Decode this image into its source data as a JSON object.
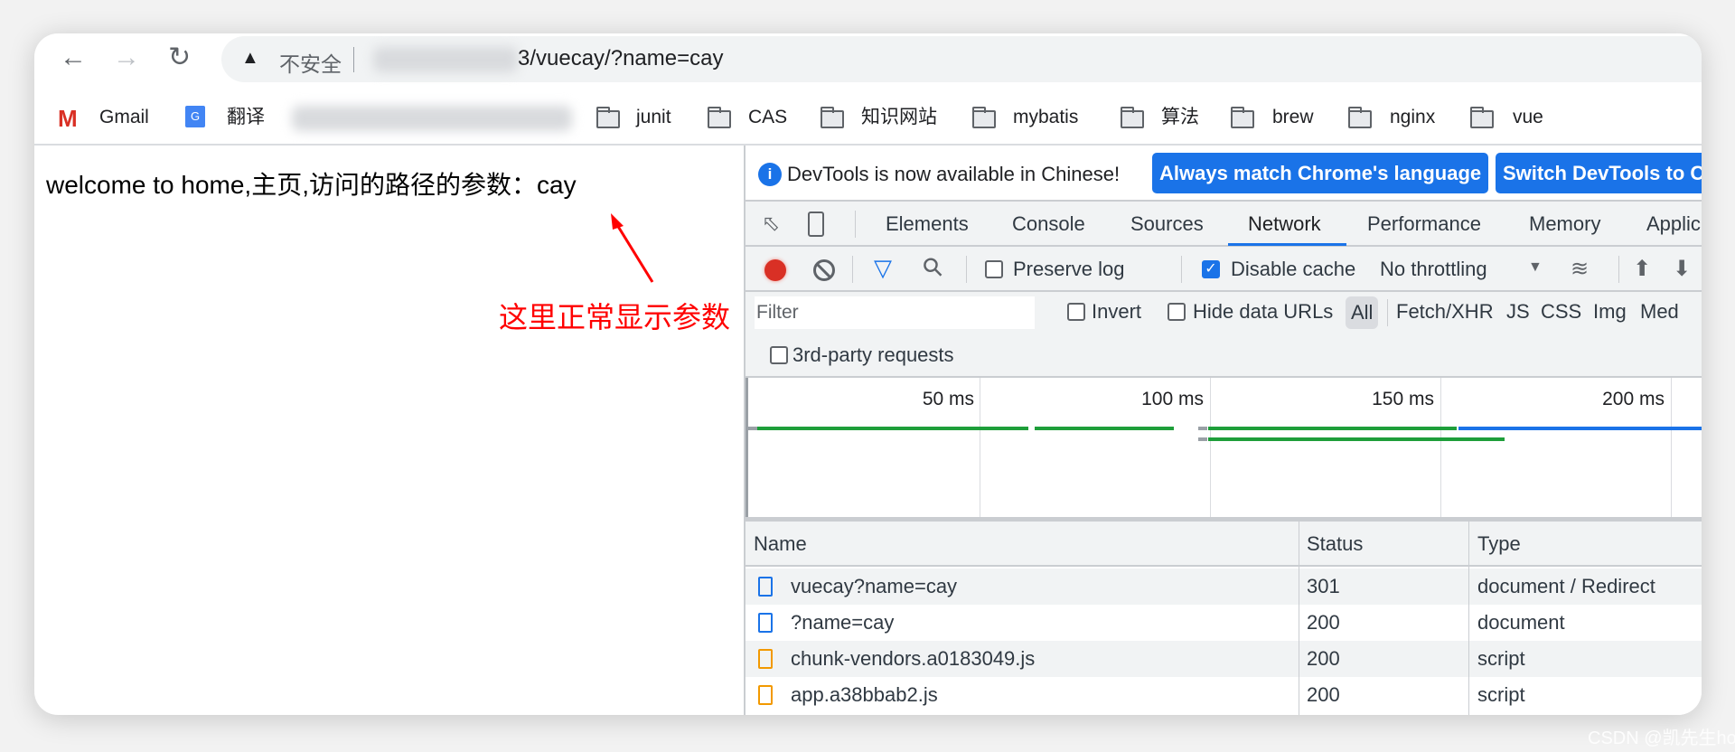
{
  "browser": {
    "address_warning": "不安全",
    "url_visible": "3/vuecay/?name=cay",
    "bookmarks": [
      {
        "label": "Gmail",
        "icon": "gmail-icon"
      },
      {
        "label": "翻译",
        "icon": "translate-icon"
      },
      {
        "label": "junit",
        "icon": "folder-icon"
      },
      {
        "label": "CAS",
        "icon": "folder-icon"
      },
      {
        "label": "知识网站",
        "icon": "folder-icon"
      },
      {
        "label": "mybatis",
        "icon": "folder-icon"
      },
      {
        "label": "算法",
        "icon": "folder-icon"
      },
      {
        "label": "brew",
        "icon": "folder-icon"
      },
      {
        "label": "nginx",
        "icon": "folder-icon"
      },
      {
        "label": "vue",
        "icon": "folder-icon"
      }
    ]
  },
  "page": {
    "text": "welcome to home,主页,访问的路径的参数：cay",
    "annotation": "这里正常显示参数",
    "annotation_color": "#ff0000"
  },
  "devtools": {
    "infobar": {
      "message": "DevTools is now available in Chinese!",
      "button1": "Always match Chrome's language",
      "button2": "Switch DevTools to C"
    },
    "tabs": [
      "Elements",
      "Console",
      "Sources",
      "Network",
      "Performance",
      "Memory",
      "Applic"
    ],
    "active_tab": "Network",
    "toolbar": {
      "preserve_log": "Preserve log",
      "preserve_log_checked": false,
      "disable_cache": "Disable cache",
      "disable_cache_checked": true,
      "throttling": "No throttling"
    },
    "filter": {
      "placeholder": "Filter",
      "invert": "Invert",
      "hide_data_urls": "Hide data URLs",
      "types": [
        "All",
        "Fetch/XHR",
        "JS",
        "CSS",
        "Img",
        "Med"
      ],
      "active_type": "All",
      "third_party": "3rd-party requests"
    },
    "timeline": {
      "ticks": [
        "50 ms",
        "100 ms",
        "150 ms",
        "200 ms"
      ]
    },
    "table": {
      "columns": [
        "Name",
        "Status",
        "Type"
      ],
      "rows": [
        {
          "name": "vuecay?name=cay",
          "status": "301",
          "type": "document / Redirect",
          "icon": "document-icon"
        },
        {
          "name": "?name=cay",
          "status": "200",
          "type": "document",
          "icon": "document-icon"
        },
        {
          "name": "chunk-vendors.a0183049.js",
          "status": "200",
          "type": "script",
          "icon": "script-icon"
        },
        {
          "name": "app.a38bbab2.js",
          "status": "200",
          "type": "script",
          "icon": "script-icon"
        }
      ]
    },
    "accent": "#1a73e8"
  },
  "watermark": "CSDN @凯先生ho"
}
